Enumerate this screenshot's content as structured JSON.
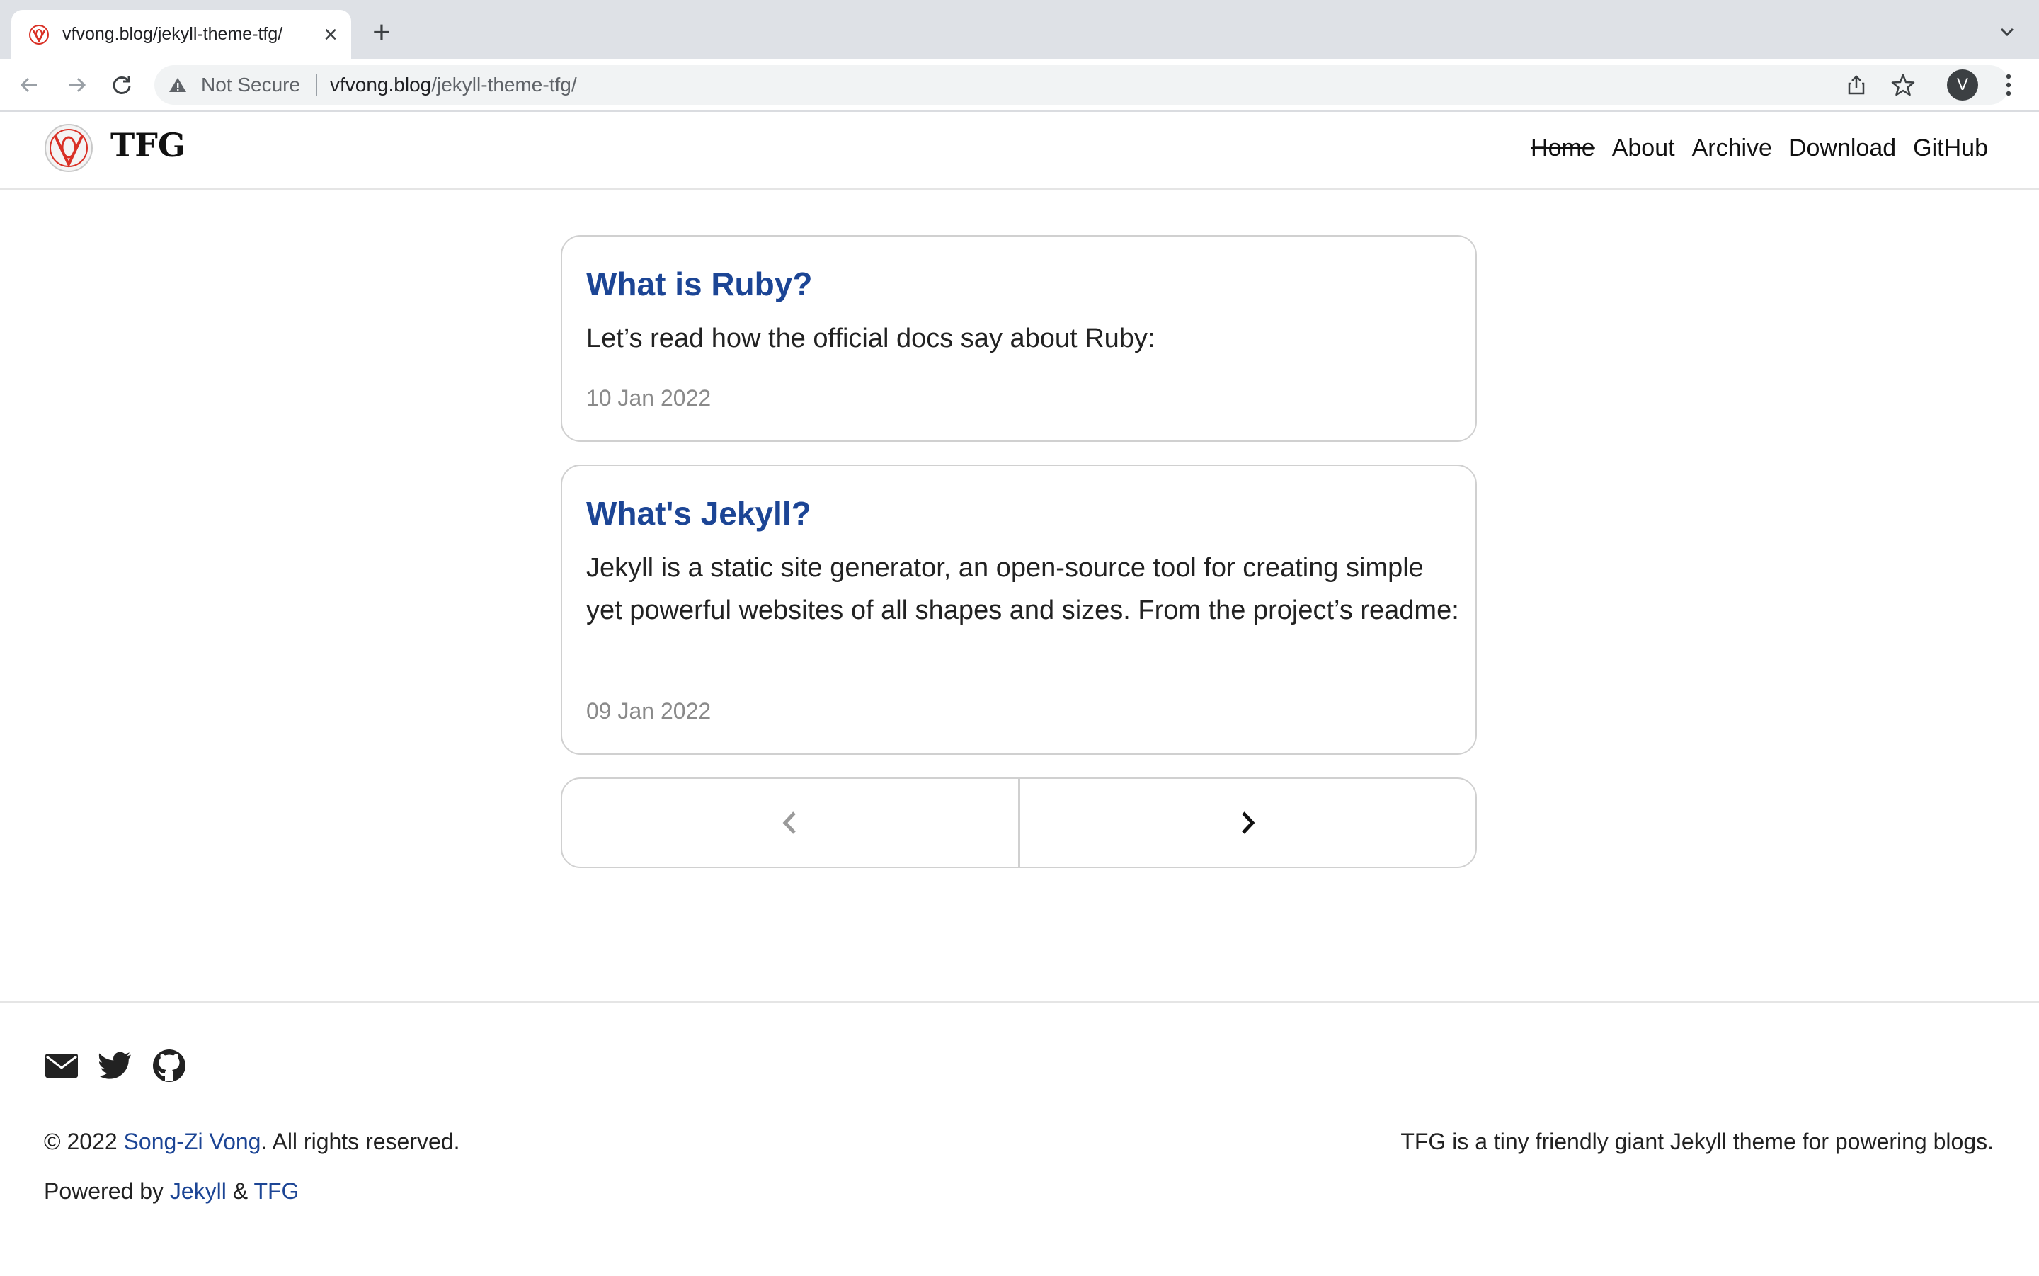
{
  "browser": {
    "tab_title": "vfvong.blog/jekyll-theme-tfg/",
    "security_label": "Not Secure",
    "url_host": "vfvong.blog",
    "url_path": "/jekyll-theme-tfg/",
    "profile_initial": "V"
  },
  "site": {
    "brand": "TFG",
    "nav": [
      "Home",
      "About",
      "Archive",
      "Download",
      "GitHub"
    ],
    "accent_color": "#1c4595"
  },
  "posts": [
    {
      "title": "What is Ruby?",
      "excerpt": "Let’s read how the official docs say about Ruby:",
      "date": "10 Jan 2022"
    },
    {
      "title": "What's Jekyll?",
      "excerpt": "Jekyll is a static site generator, an open-source tool for creating simple yet powerful websites of all shapes and sizes. From the project’s readme:",
      "date": "09 Jan 2022"
    }
  ],
  "pagination": {
    "prev_icon": "chevron-left-icon",
    "next_icon": "chevron-right-icon"
  },
  "footer": {
    "social_icons": [
      "envelope-icon",
      "twitter-icon",
      "github-icon"
    ],
    "copyright_prefix": "© 2022 ",
    "author": "Song-Zi Vong",
    "copyright_suffix": ". All rights reserved.",
    "powered_prefix": "Powered by ",
    "powered_jekyll": "Jekyll",
    "powered_amp": " & ",
    "powered_tfg": "TFG",
    "tagline": "TFG is a tiny friendly giant Jekyll theme for powering blogs."
  }
}
